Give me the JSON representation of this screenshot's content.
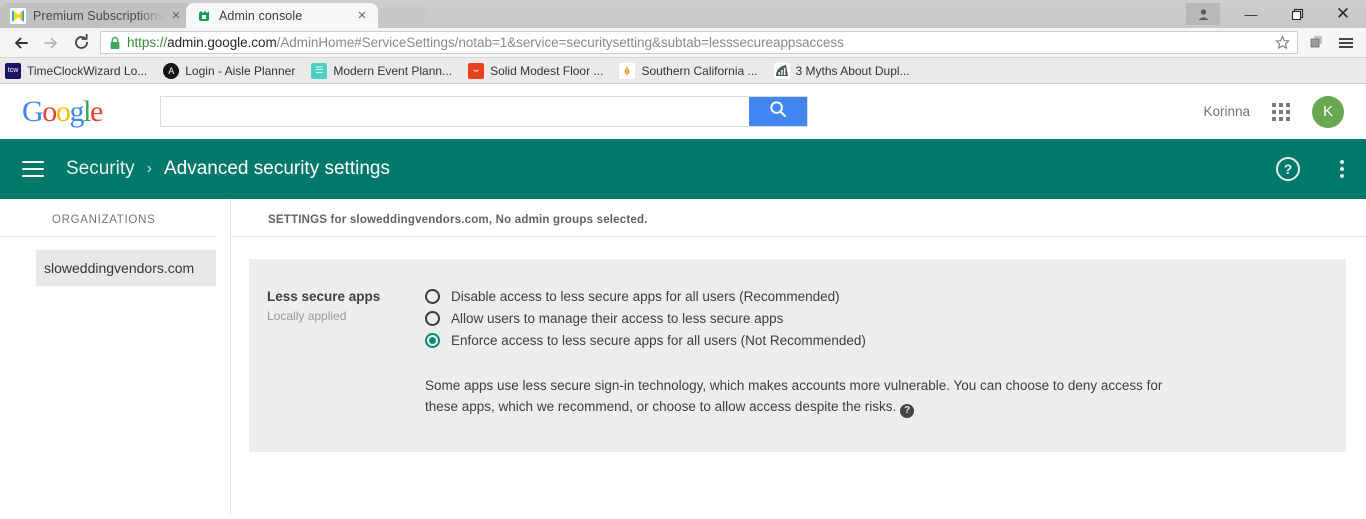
{
  "browser": {
    "tabs": [
      {
        "title": "Premium Subscriptions | W",
        "favicon": "premium-icon",
        "active": false,
        "close_label": "×"
      },
      {
        "title": "Admin console",
        "favicon": "admin-console-icon",
        "active": true,
        "close_label": "×"
      }
    ],
    "window_controls": {
      "minimize": "—",
      "maximize": "❐",
      "close": "✕",
      "profile": "profile-icon"
    },
    "nav": {
      "back": "←",
      "forward": "→",
      "reload": "↻"
    },
    "omnibox": {
      "scheme": "https://",
      "host": "admin.google.com",
      "path": "/AdminHome#ServiceSettings/notab=1&service=securitysetting&subtab=lesssecureappsaccess",
      "full_url": "https://admin.google.com/AdminHome#ServiceSettings/notab=1&service=securitysetting&subtab=lesssecureappsaccess",
      "lock": "secure-lock-icon",
      "star": "☆"
    },
    "toolbar_icons": {
      "extension": "extension-icon",
      "menu": "chrome-menu-icon"
    },
    "bookmarks": [
      {
        "label": "TimeClockWizard Lo...",
        "icon_text": "tcw",
        "icon_bg": "#1b1464",
        "icon_fg": "#ffffff"
      },
      {
        "label": "Login - Aisle Planner",
        "icon_text": "Ⓐ",
        "icon_bg": "#1a1a1a",
        "icon_fg": "#ffffff"
      },
      {
        "label": "Modern Event Plann...",
        "icon_text": "≡",
        "icon_bg": "#4dd0c4",
        "icon_fg": "#ffffff"
      },
      {
        "label": "Solid Modest Floor ...",
        "icon_text": "⌣",
        "icon_bg": "#e8411f",
        "icon_fg": "#ffffff"
      },
      {
        "label": "Southern California ...",
        "icon_text": "✈",
        "icon_bg": "#ffffff",
        "icon_fg": "#f08a24"
      },
      {
        "label": "3 Myths About Dupl...",
        "icon_text": "◧",
        "icon_bg": "#ffffff",
        "icon_fg": "#4b5a5a"
      }
    ]
  },
  "google_header": {
    "logo_letters": [
      "G",
      "o",
      "o",
      "g",
      "l",
      "e"
    ],
    "search_value": "",
    "search_placeholder": "",
    "search_button_icon": "search-icon",
    "user_name": "Korinna",
    "apps_icon": "apps-grid-icon",
    "avatar_letter": "K",
    "avatar_color": "#6aa84f"
  },
  "appbar": {
    "menu_icon": "hamburger-menu-icon",
    "breadcrumb_parent": "Security",
    "breadcrumb_separator": "›",
    "breadcrumb_current": "Advanced security settings",
    "help_icon": "?",
    "more_icon": "more-options-icon",
    "background_color": "#00796b"
  },
  "sidebar": {
    "heading": "ORGANIZATIONS",
    "items": [
      {
        "label": "sloweddingvendors.com",
        "selected": true
      }
    ]
  },
  "main": {
    "settings_header": "SETTINGS for sloweddingvendors.com, No admin groups selected.",
    "card": {
      "title": "Less secure apps",
      "subtitle": "Locally applied",
      "options": [
        {
          "label": "Disable access to less secure apps for all users (Recommended)",
          "selected": false
        },
        {
          "label": "Allow users to manage their access to less secure apps",
          "selected": false
        },
        {
          "label": "Enforce access to less secure apps for all users (Not Recommended)",
          "selected": true
        }
      ],
      "selected_color": "#00897b",
      "description": "Some apps use less secure sign-in technology, which makes accounts more vulnerable. You can choose to deny access for these apps, which we recommend, or choose to allow access despite the risks.",
      "description_help_icon": "?"
    }
  }
}
